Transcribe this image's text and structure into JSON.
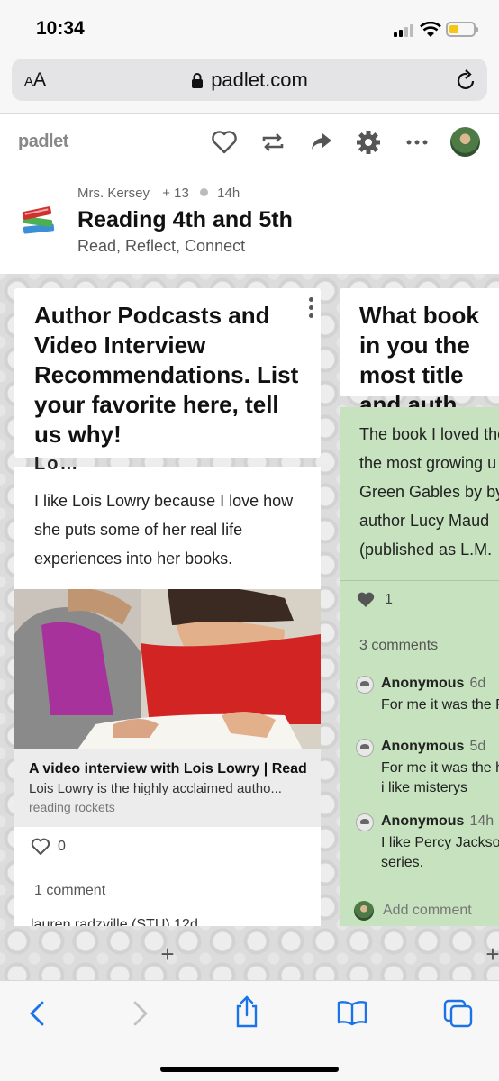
{
  "status_bar": {
    "time": "10:34"
  },
  "browser": {
    "text_size_label": "AA",
    "url": "padlet.com",
    "icons": [
      "lock-icon",
      "reload-icon",
      "back-icon",
      "forward-icon",
      "share-icon",
      "bookmarks-icon",
      "tabs-icon"
    ]
  },
  "padlet_header": {
    "logo": "padlet",
    "icons": [
      "heart-icon",
      "remake-icon",
      "share-icon",
      "settings-icon",
      "more-icon"
    ],
    "author": "Mrs. Kersey",
    "followers": "+ 13",
    "time_ago": "14h",
    "title": "Reading 4th and 5th",
    "subtitle": "Read, Reflect, Connect"
  },
  "columns": [
    {
      "title": "Author Podcasts and Video Interview Recommendations. List your favorite here, tell us why!",
      "post": {
        "title_fragment": "Lo…",
        "body": "I like Lois Lowry because I love how she puts some of her real life experiences into her books.",
        "link": {
          "title": "A video interview with Lois Lowry | Read...",
          "description": "Lois Lowry is the highly acclaimed autho...",
          "source": "reading rockets"
        },
        "likes": "0",
        "comments_count": "1 comment",
        "comment_author_partial": "lauren radzville (STU) 12d"
      }
    },
    {
      "title": "What book in you the most title and auth",
      "post": {
        "body": "The book I loved the the most growing u Green Gables by by author Lucy Maud (published as L.M.",
        "likes": "1",
        "comments_count": "3 comments",
        "comments": [
          {
            "author": "Anonymous",
            "time": "6d",
            "text": "For me it was the F"
          },
          {
            "author": "Anonymous",
            "time": "5d",
            "text": "For me it was the h",
            "text2": "i like misterys"
          },
          {
            "author": "Anonymous",
            "time": "14h",
            "text": "I like Percy Jackso",
            "text2": "series."
          }
        ],
        "add_comment": "Add comment"
      }
    }
  ],
  "colors": {
    "accent": "#1a73e8",
    "post_green": "#c6e2be"
  }
}
